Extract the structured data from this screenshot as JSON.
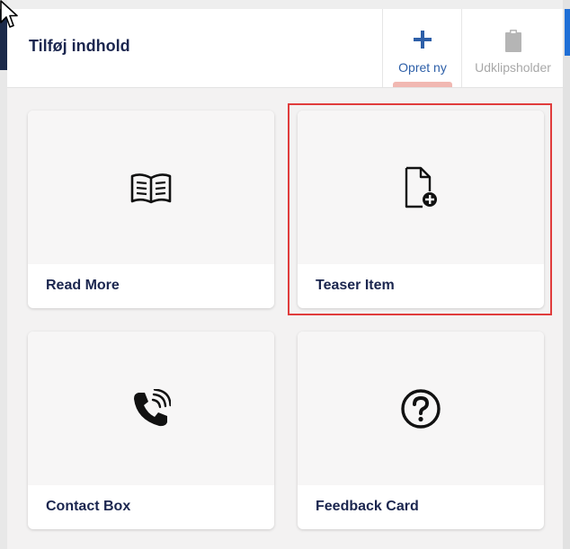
{
  "dialog": {
    "title": "Tilføj indhold",
    "tabs": [
      {
        "label": "Opret ny",
        "icon": "plus-icon",
        "active": true
      },
      {
        "label": "Udklipsholder",
        "icon": "clipboard-icon",
        "active": false
      }
    ]
  },
  "cards": [
    {
      "label": "Read More",
      "icon": "book-open-icon"
    },
    {
      "label": "Teaser Item",
      "icon": "document-add-icon"
    },
    {
      "label": "Contact Box",
      "icon": "phone-ringing-icon"
    },
    {
      "label": "Feedback Card",
      "icon": "question-circle-icon"
    }
  ],
  "colors": {
    "title": "#1b264f",
    "active_tab": "#2d5fa8",
    "inactive_tab": "#a8a8a8",
    "highlight": "#e03c3c",
    "tab_indicator": "#f1b8b2"
  }
}
